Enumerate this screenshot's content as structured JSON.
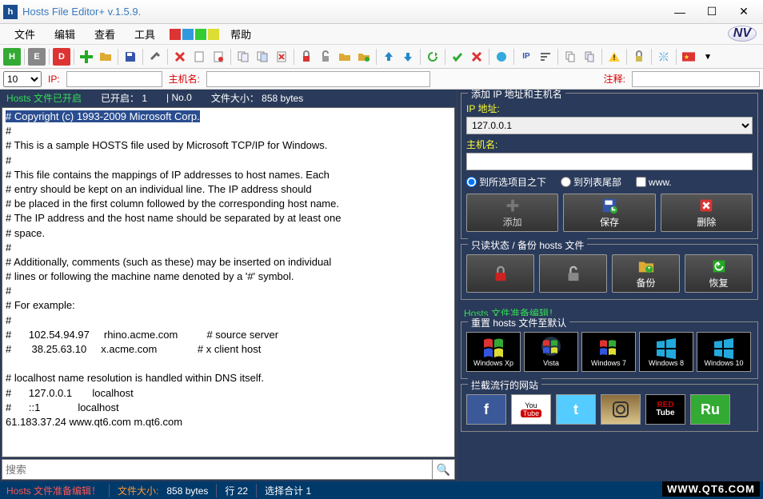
{
  "title": "Hosts File Editor+ v.1.5.9.",
  "menus": [
    "文件",
    "编辑",
    "查看",
    "工具",
    "",
    "",
    "帮助"
  ],
  "filter": {
    "count": "10",
    "iplbl": "IP:",
    "hostlbl": "主机名:",
    "remarklbl": "注释:"
  },
  "status": {
    "opened": "Hosts 文件已开启",
    "enabled": "已开启： 1",
    "no": "| No.0",
    "size": "文件大小： 858 bytes"
  },
  "editor": {
    "selected": "# Copyright (c) 1993-2009 Microsoft Corp.",
    "rest": "#\n# This is a sample HOSTS file used by Microsoft TCP/IP for Windows.\n#\n# This file contains the mappings of IP addresses to host names. Each\n# entry should be kept on an individual line. The IP address should\n# be placed in the first column followed by the corresponding host name.\n# The IP address and the host name should be separated by at least one\n# space.\n#\n# Additionally, comments (such as these) may be inserted on individual\n# lines or following the machine name denoted by a '#' symbol.\n#\n# For example:\n#\n#      102.54.94.97     rhino.acme.com          # source server\n#       38.25.63.10     x.acme.com              # x client host\n\n# localhost name resolution is handled within DNS itself.\n#\t127.0.0.1       localhost\n#\t::1             localhost\n61.183.37.24 www.qt6.com m.qt6.com"
  },
  "search": {
    "placeholder": "搜索"
  },
  "addpanel": {
    "title": "添加 IP 地址和主机名",
    "iplbl": "IP 地址:",
    "ipval": "127.0.0.1",
    "hostlbl": "主机名:",
    "r1": "到所选项目之下",
    "r2": "到列表尾部",
    "r3": "www.",
    "add": "添加",
    "save": "保存",
    "del": "删除"
  },
  "readonly": {
    "title": "只读状态 / 备份 hosts 文件",
    "backup": "备份",
    "restore": "恢复"
  },
  "readymsg": "Hosts 文件准备编辑！",
  "reset": {
    "title": "重置 hosts 文件至默认"
  },
  "os": [
    "Windows Xp",
    "Vista",
    "Windows 7",
    "Windows 8",
    "Windows 10"
  ],
  "block": {
    "title": "拦截流行的网站"
  },
  "bottom": {
    "ready": "Hosts 文件准备编辑！",
    "sizelbl": "文件大小:",
    "sizeval": "858 bytes",
    "line": "行 22",
    "sel": "选择合计 1"
  },
  "qt": "WWW.QT6.COM"
}
